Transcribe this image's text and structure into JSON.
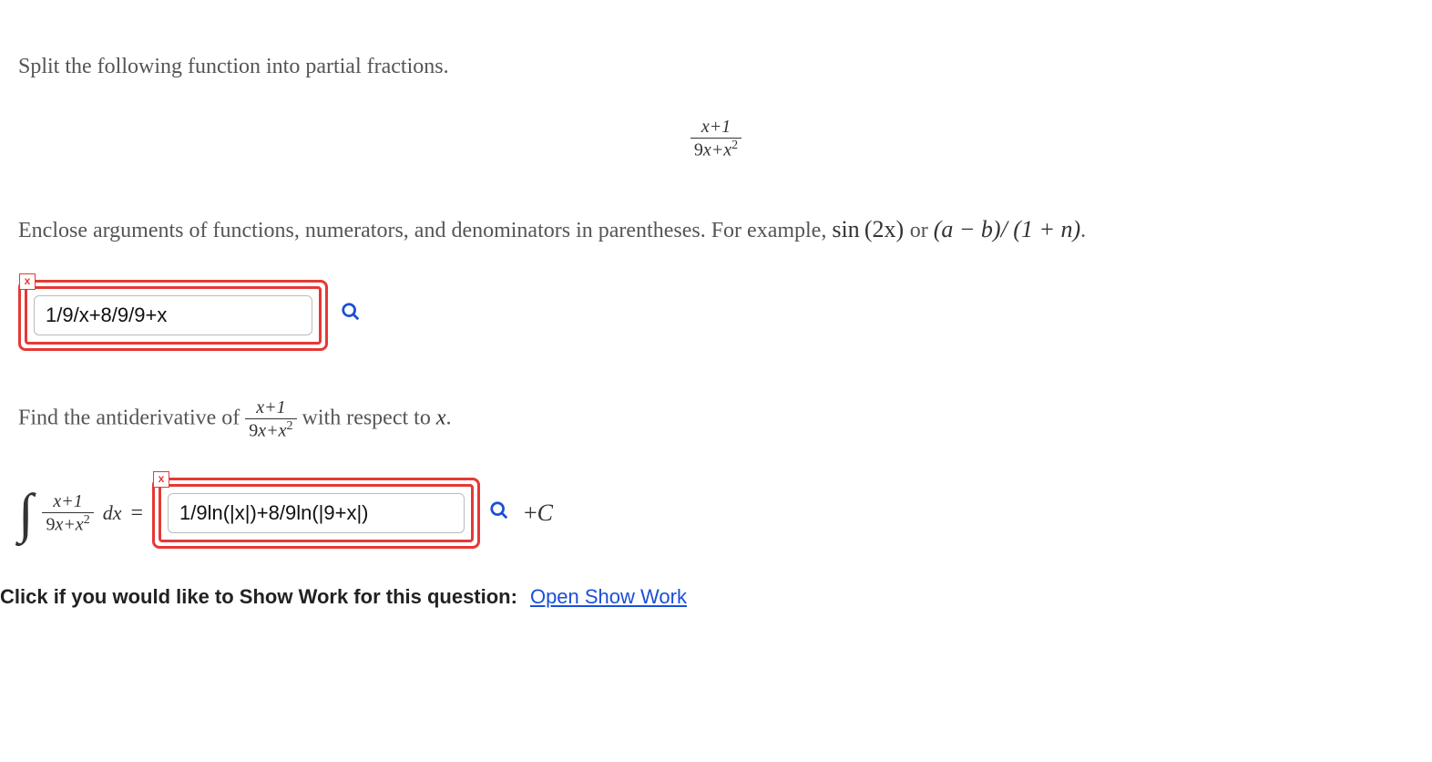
{
  "q1_instruction": "Split the following function into partial fractions.",
  "fraction": {
    "num": "x+1",
    "den_a": "9",
    "den_rest": "x+x",
    "den_exp": "2"
  },
  "enclose_pre": "Enclose arguments of functions, numerators, and denominators in parentheses. For example, ",
  "example_sin": "sin (2x)",
  "or_text": " or ",
  "example_frac": "(a − b)/ (1 + n)",
  "period": ".",
  "answer1_value": "1/9/x+8/9/9+x",
  "q2_pre": "Find the antiderivative of ",
  "q2_post_a": " with respect to ",
  "q2_post_x": "x",
  "q2_post_dot": ".",
  "integral_dx": "dx",
  "equals": "=",
  "answer2_value": "1/9ln(|x|)+8/9ln(|9+x|)",
  "plus_c": "+C",
  "x_badge": "x",
  "showwork_bold": "Click if you would like to Show Work for this question:",
  "showwork_link": "Open Show Work"
}
